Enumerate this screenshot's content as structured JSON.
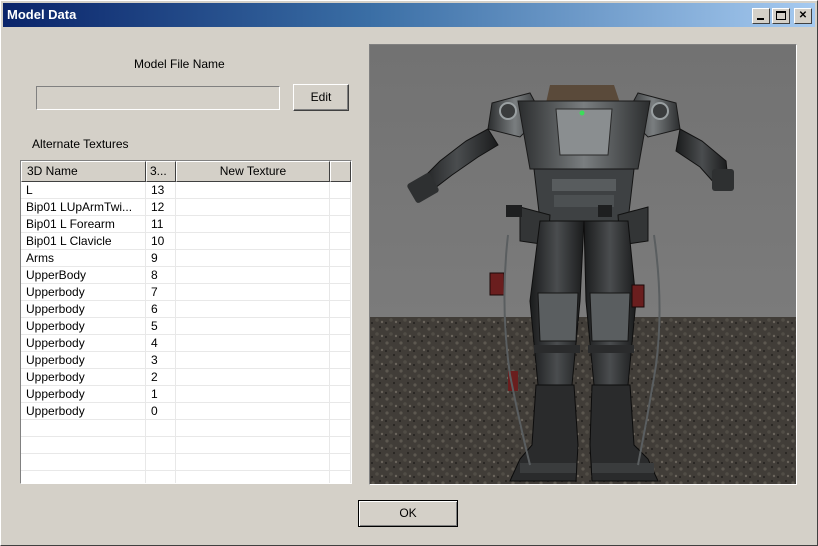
{
  "window": {
    "title": "Model Data",
    "controls": {
      "minimize": "_",
      "maximize": "□",
      "close": "✕"
    }
  },
  "model": {
    "label": "Model File Name",
    "value": "",
    "edit_label": "Edit"
  },
  "textures": {
    "label": "Alternate Textures",
    "columns": [
      "3D Name",
      "3...",
      "New Texture",
      ""
    ],
    "rows": [
      [
        "L",
        "13",
        ""
      ],
      [
        "Bip01 LUpArmTwi...",
        "12",
        ""
      ],
      [
        "Bip01 L Forearm",
        "11",
        ""
      ],
      [
        "Bip01 L Clavicle",
        "10",
        ""
      ],
      [
        "Arms",
        "9",
        ""
      ],
      [
        "UpperBody",
        "8",
        ""
      ],
      [
        "Upperbody",
        "7",
        ""
      ],
      [
        "Upperbody",
        "6",
        ""
      ],
      [
        "Upperbody",
        "5",
        ""
      ],
      [
        "Upperbody",
        "4",
        ""
      ],
      [
        "Upperbody",
        "3",
        ""
      ],
      [
        "Upperbody",
        "2",
        ""
      ],
      [
        "Upperbody",
        "1",
        ""
      ],
      [
        "Upperbody",
        "0",
        ""
      ],
      [
        "",
        "",
        ""
      ],
      [
        "",
        "",
        ""
      ],
      [
        "",
        "",
        ""
      ],
      [
        "",
        "",
        ""
      ]
    ]
  },
  "preview": {
    "subject": "power armor model preview",
    "background_color": "#767676",
    "ground_color": "#4a4640"
  },
  "ok_label": "OK"
}
